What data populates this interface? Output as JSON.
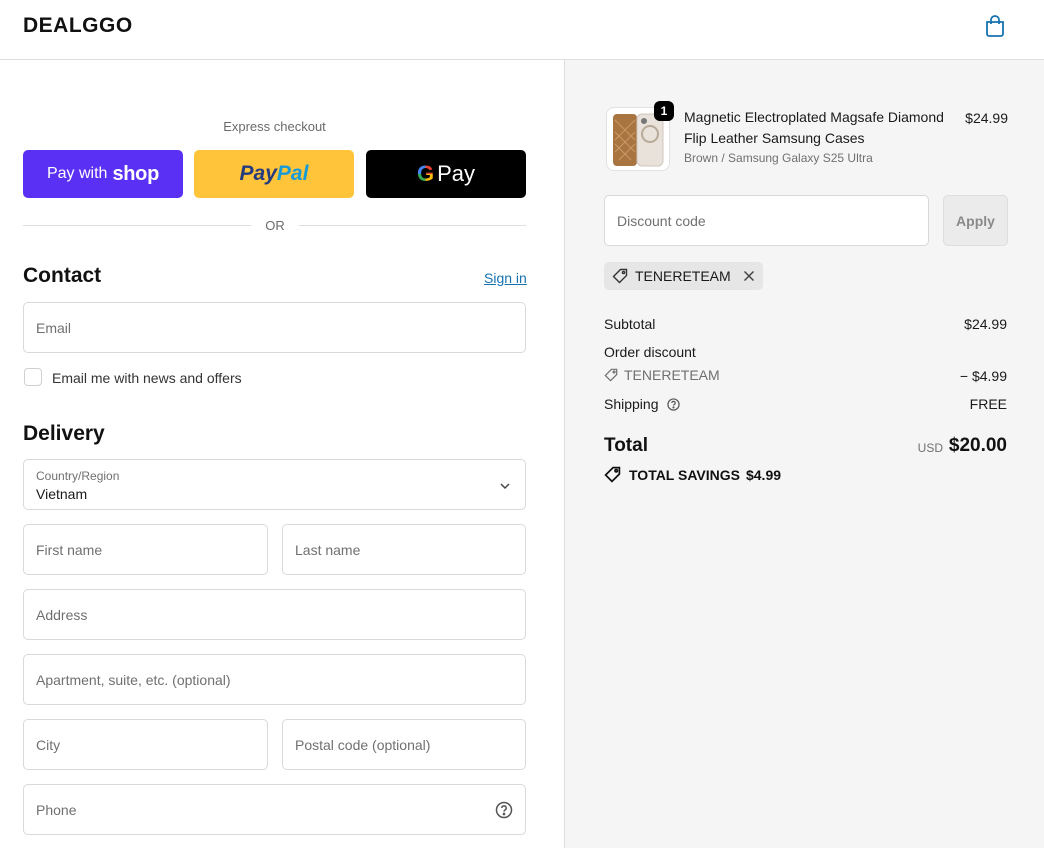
{
  "header": {
    "logo": "DEALGGO",
    "cart_icon": "shopping-bag-icon"
  },
  "express": {
    "title": "Express checkout",
    "shop_prefix": "Pay with",
    "shop_brand": "shop",
    "paypal_a": "Pay",
    "paypal_b": "Pal",
    "gpay_g": "G",
    "gpay_label": "Pay",
    "or": "OR"
  },
  "contact": {
    "title": "Contact",
    "sign_in": "Sign in",
    "email_placeholder": "Email",
    "news_label": "Email me with news and offers"
  },
  "delivery": {
    "title": "Delivery",
    "country_label": "Country/Region",
    "country_value": "Vietnam",
    "first_name_placeholder": "First name",
    "last_name_placeholder": "Last name",
    "address_placeholder": "Address",
    "apartment_placeholder": "Apartment, suite, etc. (optional)",
    "city_placeholder": "City",
    "postal_placeholder": "Postal code (optional)",
    "phone_placeholder": "Phone"
  },
  "order": {
    "item": {
      "qty": "1",
      "name": "Magnetic Electroplated Magsafe Diamond Flip Leather Samsung Cases",
      "variant": "Brown / Samsung Galaxy S25 Ultra",
      "price": "$24.99"
    },
    "discount_placeholder": "Discount code",
    "apply": "Apply",
    "applied_code": "TENERETEAM",
    "subtotal_label": "Subtotal",
    "subtotal_value": "$24.99",
    "order_discount_label": "Order discount",
    "discount_code": "TENERETEAM",
    "discount_value": "− $4.99",
    "shipping_label": "Shipping",
    "shipping_value": "FREE",
    "total_label": "Total",
    "currency": "USD",
    "total_value": "$20.00",
    "savings_label": "TOTAL SAVINGS",
    "savings_value": "$4.99"
  },
  "colors": {
    "shop": "#5a31f4",
    "paypal": "#ffc439",
    "gpay": "#000000",
    "link": "#1773b0"
  }
}
